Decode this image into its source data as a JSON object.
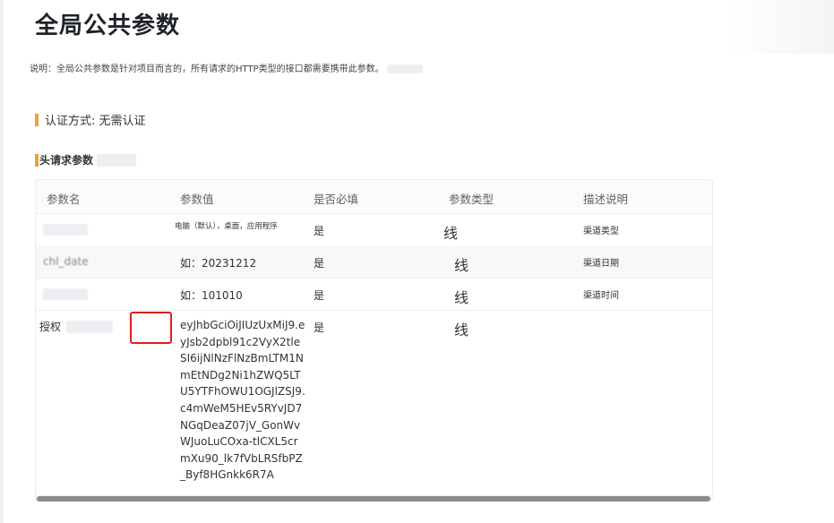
{
  "page": {
    "title": "全局公共参数",
    "description": "说明：全局公共参数是针对项目而言的，所有请求的HTTP类型的接口都需要携带此参数。"
  },
  "auth": {
    "label": "认证方式: 无需认证"
  },
  "headers_section": {
    "label": "头请求参数"
  },
  "table": {
    "columns": [
      "参数名",
      "参数值",
      "是否必填",
      "参数类型",
      "描述说明"
    ],
    "rows": [
      {
        "name": "",
        "value": "电脑（默认），桌面，应用程序",
        "required": "是",
        "type": "线",
        "desc": "渠道类型"
      },
      {
        "name": "chl_date",
        "value": "如：20231212",
        "required": "是",
        "type": "线",
        "desc": "渠道日期"
      },
      {
        "name": "",
        "value": "如：101010",
        "required": "是",
        "type": "线",
        "desc": "渠道时间"
      },
      {
        "name": "授权",
        "value": "eyJhbGciOiJIUzUxMiJ9.eyJsb2dpbl91c2VyX2tleSI6ijNlNzFlNzBmLTM1NmEtNDg2Ni1hZWQ5LTU5YTFhOWU1OGJlZSJ9.c4mWeM5HEv5RYvJD7NGqDeaZ07jV_GonWvWJuoLuCOxa-tlCXL5crmXu90_lk7fVbLRSfbPZ_Byf8HGnkk6R7A",
        "required": "是",
        "type": "线",
        "desc": ""
      }
    ]
  },
  "colors": {
    "accent_bar": "#e6a23c",
    "highlight_box": "#e0201f",
    "scrollbar": "#8c8c8c"
  }
}
